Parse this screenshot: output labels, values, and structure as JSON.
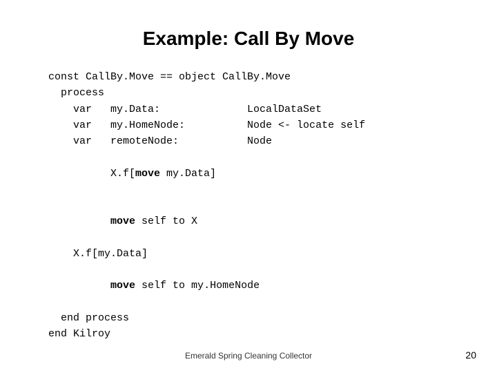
{
  "slide": {
    "title": "Example: Call By Move",
    "footer": "Emerald Spring Cleaning Collector",
    "page_number": "20",
    "code": {
      "line1": "const CallBy.Move == object CallBy.Move",
      "line2": "  process",
      "line3": "    var   my.Data:              LocalDataSet",
      "line4": "    var   my.HomeNode:          Node <- locate self",
      "line5": "    var   remoteNode:           Node",
      "line6_pre": "    X.f[",
      "line6_bold": "move",
      "line6_post": " my.Data]",
      "line7_pre": "    ",
      "line7_bold": "move",
      "line7_post": " self to X",
      "line8": "    X.f[my.Data]",
      "line9_pre": "    ",
      "line9_bold": "move",
      "line9_post": " self to my.HomeNode",
      "line10": "  end process",
      "line11": "end Kilroy"
    }
  }
}
